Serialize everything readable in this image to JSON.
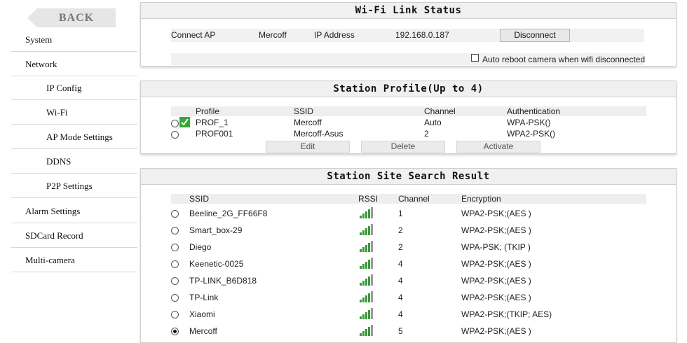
{
  "sidebar": {
    "back_label": "BACK",
    "items": [
      {
        "label": "System"
      },
      {
        "label": "Network"
      },
      {
        "label": "IP Config"
      },
      {
        "label": "Wi-Fi"
      },
      {
        "label": "AP Mode Settings"
      },
      {
        "label": "DDNS"
      },
      {
        "label": "P2P Settings"
      },
      {
        "label": "Alarm Settings"
      },
      {
        "label": "SDCard Record"
      },
      {
        "label": "Multi-camera"
      }
    ]
  },
  "link_status": {
    "title": "Wi-Fi Link Status",
    "connect_ap_label": "Connect AP",
    "connect_ap_value": "Mercoff",
    "ip_label": "IP Address",
    "ip_value": "192.168.0.187",
    "disconnect_label": "Disconnect",
    "auto_reboot_label": "Auto reboot camera when wifi disconnected"
  },
  "station_profile": {
    "title": "Station Profile(Up to 4)",
    "headers": {
      "profile": "Profile",
      "ssid": "SSID",
      "channel": "Channel",
      "auth": "Authentication"
    },
    "rows": [
      {
        "profile": "PROF_1",
        "ssid": "Mercoff",
        "channel": "Auto",
        "auth": "WPA-PSK()"
      },
      {
        "profile": "PROF001",
        "ssid": "Mercoff-Asus",
        "channel": "2",
        "auth": "WPA2-PSK()"
      }
    ],
    "buttons": {
      "edit": "Edit",
      "delete": "Delete",
      "activate": "Activate"
    }
  },
  "site_search": {
    "title": "Station Site Search Result",
    "headers": {
      "ssid": "SSID",
      "rssi": "RSSI",
      "channel": "Channel",
      "encryption": "Encryption"
    },
    "rows": [
      {
        "ssid": "Beeline_2G_FF66F8",
        "channel": "1",
        "encryption": "WPA2-PSK;(AES )"
      },
      {
        "ssid": "Smart_box-29",
        "channel": "2",
        "encryption": "WPA2-PSK;(AES )"
      },
      {
        "ssid": "Diego",
        "channel": "2",
        "encryption": "WPA-PSK; (TKIP )"
      },
      {
        "ssid": "Keenetic-0025",
        "channel": "4",
        "encryption": "WPA2-PSK;(AES )"
      },
      {
        "ssid": "TP-LINK_B6D818",
        "channel": "4",
        "encryption": "WPA2-PSK;(AES )"
      },
      {
        "ssid": "TP-Link",
        "channel": "4",
        "encryption": "WPA2-PSK;(AES )"
      },
      {
        "ssid": "Xiaomi",
        "channel": "4",
        "encryption": "WPA2-PSK;(TKIP; AES)"
      },
      {
        "ssid": "Mercoff",
        "channel": "5",
        "encryption": "WPA2-PSK;(AES )"
      }
    ]
  },
  "colors": {
    "signal": "#3a9a3a",
    "check": "#2e9e2e",
    "header_bg": "#f0f0f0"
  }
}
